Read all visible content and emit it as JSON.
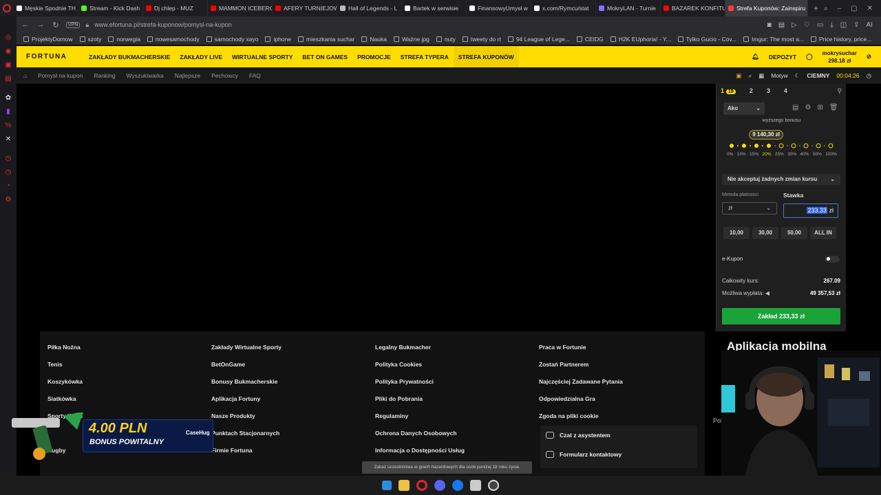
{
  "browser": {
    "tabs": [
      {
        "label": "Męskie Spodnie TH",
        "color": "#ffffff"
      },
      {
        "label": "Stream - Kick Dash",
        "color": "#53fc18"
      },
      {
        "label": "Dj chlep - MUZ",
        "color": "#ff0000"
      },
      {
        "label": "MAMMON ICEBERG",
        "color": "#ff0000"
      },
      {
        "label": "AFERY TURNIEJOW",
        "color": "#ff0000"
      },
      {
        "label": "Hall of Legends - L",
        "color": "#bbbbbb"
      },
      {
        "label": "Bartek w serwisie",
        "color": "#ffffff"
      },
      {
        "label": "FinansowyUmysł w",
        "color": "#ffffff"
      },
      {
        "label": "x.com/Rymcu/stat",
        "color": "#ffffff"
      },
      {
        "label": "MokryLAN - Turnie",
        "color": "#8a6cff"
      },
      {
        "label": "BAZAREK KONFITU",
        "color": "#ff0000"
      },
      {
        "label": "Strefa Kuponów: Zainspiru",
        "color": "#ff3b3b",
        "active": true
      }
    ],
    "vpn": "VPN",
    "url": "www.efortuna.pl/strefa-kuponow/pomysl-na-kupon",
    "ai_label": "AI",
    "bookmarks": [
      "ProjektyDomow",
      "szoty",
      "norwegia",
      "nowesamochody",
      "samochody xayo",
      "iphone",
      "mieszkania suchar",
      "Nauka",
      "Ważne jpg",
      "nuty",
      "tweety do rt",
      "94 League of Lege...",
      "CEIDG",
      "H2K EUphoria! - Y...",
      "Tylko Gucio - Cov...",
      "Imgur: The most a...",
      "Price history, price..."
    ]
  },
  "header": {
    "logo": "FORTUNA",
    "nav": [
      "ZAKŁADY BUKMACHERSKIE",
      "ZAKŁADY LIVE",
      "WIRTUALNE SPORTY",
      "BET ON GAMES",
      "PROMOCJE",
      "STREFA TYPERA",
      "STREFA KUPONÓW"
    ],
    "deposit": "DEPOZYT",
    "username": "mokrysuchar",
    "balance": "298.18 zł"
  },
  "subnav": {
    "items": [
      "Pomysł na kupon",
      "Ranking",
      "Wyszukiwarka",
      "Najlepsze",
      "Pechowcy",
      "FAQ"
    ],
    "motyw": "Motyw",
    "theme": "CIEMNY",
    "time": "00:04:26"
  },
  "betslip": {
    "tabs": [
      "1",
      "2",
      "3",
      "4"
    ],
    "tab1_badge": "19",
    "bet_type": "Ako",
    "bonus_title": "wyższego bonusu",
    "bonus_amount": "9 140,30 zł",
    "bonus_levels": [
      "0%",
      "10%",
      "15%",
      "20%",
      "25%",
      "30%",
      "40%",
      "50%",
      "100%"
    ],
    "bonus_active_level": "20%",
    "odds_change": "Nie akceptuj żadnych zmian kursu",
    "payment_label": "Metoda płatności",
    "payment_value": "zł",
    "stake_label": "Stawka",
    "stake_value": "233.33",
    "stake_currency": "zł",
    "quick": [
      "10,00",
      "30,00",
      "50,00",
      "ALL IN"
    ],
    "ekupon": "e-Kupon",
    "total_odds_label": "Całkowity kurs:",
    "total_odds": "267.09",
    "payout_label": "Możliwa wypłata:",
    "payout": "49 357,53 zł",
    "place_bet": "Zakład 233,33 zł"
  },
  "footer": {
    "col1": [
      "Piłka Nożna",
      "Tenis",
      "Koszykówka",
      "Siatkówka",
      "Sporty Walki",
      "",
      "Rugby"
    ],
    "col2": [
      "Zakłady Wirtualne Sporty",
      "BetOnGame",
      "Bonusy Bukmacherskie",
      "Aplikacja Fortuny",
      "Nasze Produkty",
      "Punktach Stacjonarnych",
      "Firmie Fortuna"
    ],
    "col3": [
      "Legalny Bukmacher",
      "Polityka Cookies",
      "Polityka Prywatności",
      "Pliki do Pobrania",
      "Regulaminy",
      "Ochrona Danych Osobowych",
      "Informacja o Dostępności Usług"
    ],
    "col4": [
      "Praca w Fortunie",
      "Zostań Partnerem",
      "Najczęściej Zadawane Pytania",
      "Odpowiedzialna Gra",
      "Zgoda na pliki cookie"
    ],
    "chat": "Czat z asystentem",
    "form": "Formularz kontaktowy",
    "app_heading": "Aplikacja mobilna",
    "pol": "Pol",
    "warning": "Zakaz uczestnictwa w grach hazardowych dla osób poniżej 18 roku życia."
  },
  "ad": {
    "amount": "4.00 PLN",
    "subtitle": "BONUS POWITALNY",
    "brand": "CaseHug"
  }
}
